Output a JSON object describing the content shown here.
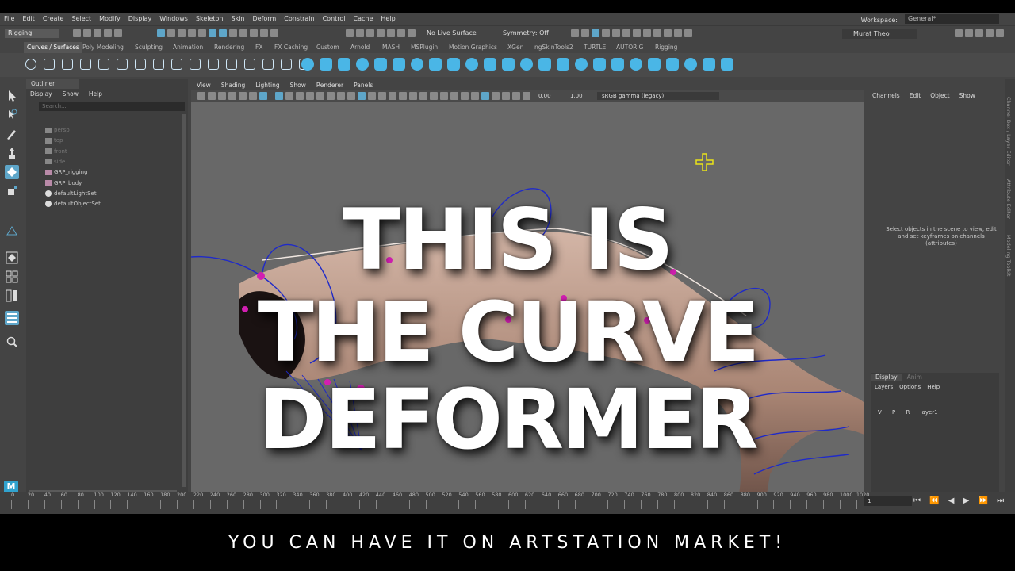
{
  "menubar": [
    "File",
    "Edit",
    "Create",
    "Select",
    "Modify",
    "Display",
    "Windows",
    "Skeleton",
    "Skin",
    "Deform",
    "Constrain",
    "Control",
    "Cache",
    "Help"
  ],
  "workspace": {
    "label": "Workspace:",
    "value": "General*"
  },
  "status": {
    "mode": "Rigging",
    "live_surface": "No Live Surface",
    "symmetry": "Symmetry: Off",
    "user": "Murat Theo"
  },
  "shelf_tabs": [
    "Curves / Surfaces",
    "Poly Modeling",
    "Sculpting",
    "Animation",
    "Rendering",
    "FX",
    "FX Caching",
    "Custom",
    "Arnold",
    "MASH",
    "MSPlugin",
    "Motion Graphics",
    "XGen",
    "ngSkinTools2",
    "TURTLE",
    "AUTORIG",
    "Rigging"
  ],
  "outliner": {
    "title": "Outliner",
    "menu": [
      "Display",
      "Show",
      "Help"
    ],
    "search_placeholder": "Search...",
    "items": [
      {
        "label": "persp",
        "kind": "camera",
        "dim": true
      },
      {
        "label": "top",
        "kind": "camera",
        "dim": true
      },
      {
        "label": "front",
        "kind": "camera",
        "dim": true
      },
      {
        "label": "side",
        "kind": "camera",
        "dim": true
      },
      {
        "label": "GRP_rigging",
        "kind": "group",
        "dim": false
      },
      {
        "label": "GRP_body",
        "kind": "group",
        "dim": false
      },
      {
        "label": "defaultLightSet",
        "kind": "set",
        "dim": false
      },
      {
        "label": "defaultObjectSet",
        "kind": "set",
        "dim": false
      }
    ]
  },
  "viewport": {
    "menu": [
      "View",
      "Shading",
      "Lighting",
      "Show",
      "Renderer",
      "Panels"
    ],
    "value_a": "0.00",
    "value_b": "1.00",
    "color_space": "sRGB gamma (legacy)"
  },
  "channel_box": {
    "menu": [
      "Channels",
      "Edit",
      "Object",
      "Show"
    ],
    "message": "Select objects in the scene to view, edit and set keyframes on channels (attributes)"
  },
  "layers": {
    "tabs": [
      "Display",
      "Anim"
    ],
    "menu": [
      "Layers",
      "Options",
      "Help"
    ],
    "row": {
      "v": "V",
      "p": "P",
      "r": "R",
      "name": "layer1"
    }
  },
  "side_tabs": [
    "Channel Box / Layer Editor",
    "Attribute Editor",
    "Modeling Toolkit"
  ],
  "timeline": {
    "ticks": [
      "0",
      "20",
      "40",
      "60",
      "80",
      "100",
      "120",
      "140",
      "160",
      "180",
      "200",
      "220",
      "240",
      "260",
      "280",
      "300",
      "320",
      "340",
      "360",
      "380",
      "400",
      "420",
      "440",
      "460",
      "480",
      "500",
      "520",
      "540",
      "560",
      "580",
      "600",
      "620",
      "640",
      "660",
      "680",
      "700",
      "720",
      "740",
      "760",
      "780",
      "800",
      "820",
      "840",
      "860",
      "880",
      "900",
      "920",
      "940",
      "960",
      "980",
      "1000",
      "1020"
    ],
    "current_frame": "1"
  },
  "overlay": {
    "line1": "THIS IS",
    "line2": "THE CURVE DEFORMER",
    "caption": "YOU CAN HAVE IT ON ARTSTATION MARKET!"
  }
}
